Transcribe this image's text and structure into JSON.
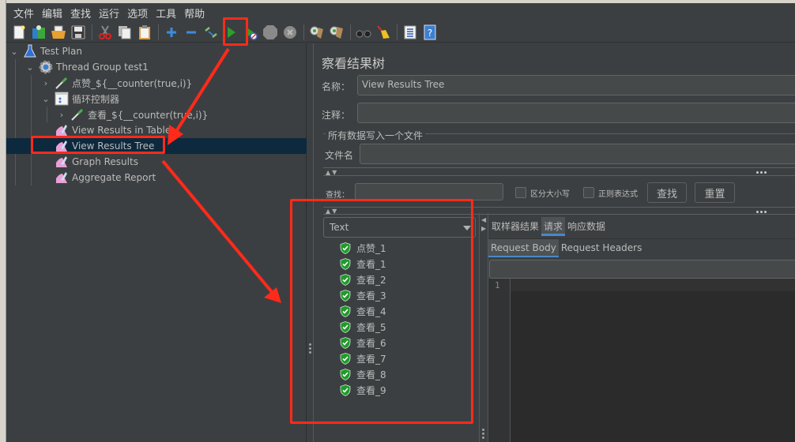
{
  "menubar": {
    "items": [
      "文件",
      "编辑",
      "查找",
      "运行",
      "选项",
      "工具",
      "帮助"
    ]
  },
  "toolbar": {
    "buttons": [
      {
        "name": "new-icon",
        "label": "New"
      },
      {
        "name": "templates-icon",
        "label": "Templates"
      },
      {
        "name": "open-icon",
        "label": "Open"
      },
      {
        "name": "save-icon",
        "label": "Save"
      },
      {
        "name": "cut-icon",
        "label": "Cut"
      },
      {
        "name": "copy-icon",
        "label": "Copy"
      },
      {
        "name": "paste-icon",
        "label": "Paste"
      },
      {
        "name": "expand-icon",
        "label": "Expand"
      },
      {
        "name": "collapse-icon",
        "label": "Collapse"
      },
      {
        "name": "toggle-icon",
        "label": "Toggle"
      },
      {
        "name": "start-icon",
        "label": "Start"
      },
      {
        "name": "start-no-pause-icon",
        "label": "Start no pauses"
      },
      {
        "name": "stop-icon",
        "label": "Stop"
      },
      {
        "name": "shutdown-icon",
        "label": "Shutdown"
      },
      {
        "name": "clear-icon",
        "label": "Clear"
      },
      {
        "name": "clear-all-icon",
        "label": "Clear All"
      },
      {
        "name": "search-icon",
        "label": "Search"
      },
      {
        "name": "reset-search-icon",
        "label": "Reset Search"
      },
      {
        "name": "function-helper-icon",
        "label": "Function Helper"
      },
      {
        "name": "help-icon",
        "label": "Help"
      }
    ]
  },
  "tree": {
    "items": [
      {
        "label": "Test Plan",
        "icon": "test-plan-icon",
        "level": 0,
        "expanded": true
      },
      {
        "label": "Thread Group test1",
        "icon": "thread-group-icon",
        "level": 1,
        "expanded": true
      },
      {
        "label": "点赞_${__counter(true,i)}",
        "icon": "sampler-icon",
        "level": 2,
        "expanded": false
      },
      {
        "label": "循环控制器",
        "icon": "loop-controller-icon",
        "level": 2,
        "expanded": true
      },
      {
        "label": "查看_${__counter(true,i)}",
        "icon": "sampler-icon",
        "level": 3,
        "expanded": false
      },
      {
        "label": "View Results in Table",
        "icon": "listener-icon",
        "level": 2
      },
      {
        "label": "View Results Tree",
        "icon": "listener-icon",
        "level": 2,
        "selected": true
      },
      {
        "label": "Graph Results",
        "icon": "listener-icon",
        "level": 2
      },
      {
        "label": "Aggregate Report",
        "icon": "listener-icon",
        "level": 2
      }
    ]
  },
  "panel": {
    "title": "察看结果树",
    "name_label": "名称：",
    "name_value": "View Results Tree",
    "comment_label": "注释：",
    "comment_value": "",
    "file_group_label": "所有数据写入一个文件",
    "filename_label": "文件名",
    "filename_value": "",
    "search_label": "查找：",
    "search_value": "",
    "case_sensitive_label": "区分大小写",
    "case_sensitive_checked": false,
    "regex_label": "正则表达式",
    "regex_checked": false,
    "find_button": "查找",
    "reset_button": "重置"
  },
  "results": {
    "renderer": "Text",
    "items": [
      "点赞_1",
      "查看_1",
      "查看_2",
      "查看_3",
      "查看_4",
      "查看_5",
      "查看_6",
      "查看_7",
      "查看_8",
      "查看_9"
    ]
  },
  "detail": {
    "tabs": [
      "取样器结果",
      "请求",
      "响应数据"
    ],
    "active_tab": 1,
    "subtabs": [
      "Request Body",
      "Request Headers"
    ],
    "active_subtab": 0,
    "line_numbers": [
      "1"
    ]
  },
  "annotations": {
    "color": "#ff2a1a"
  }
}
